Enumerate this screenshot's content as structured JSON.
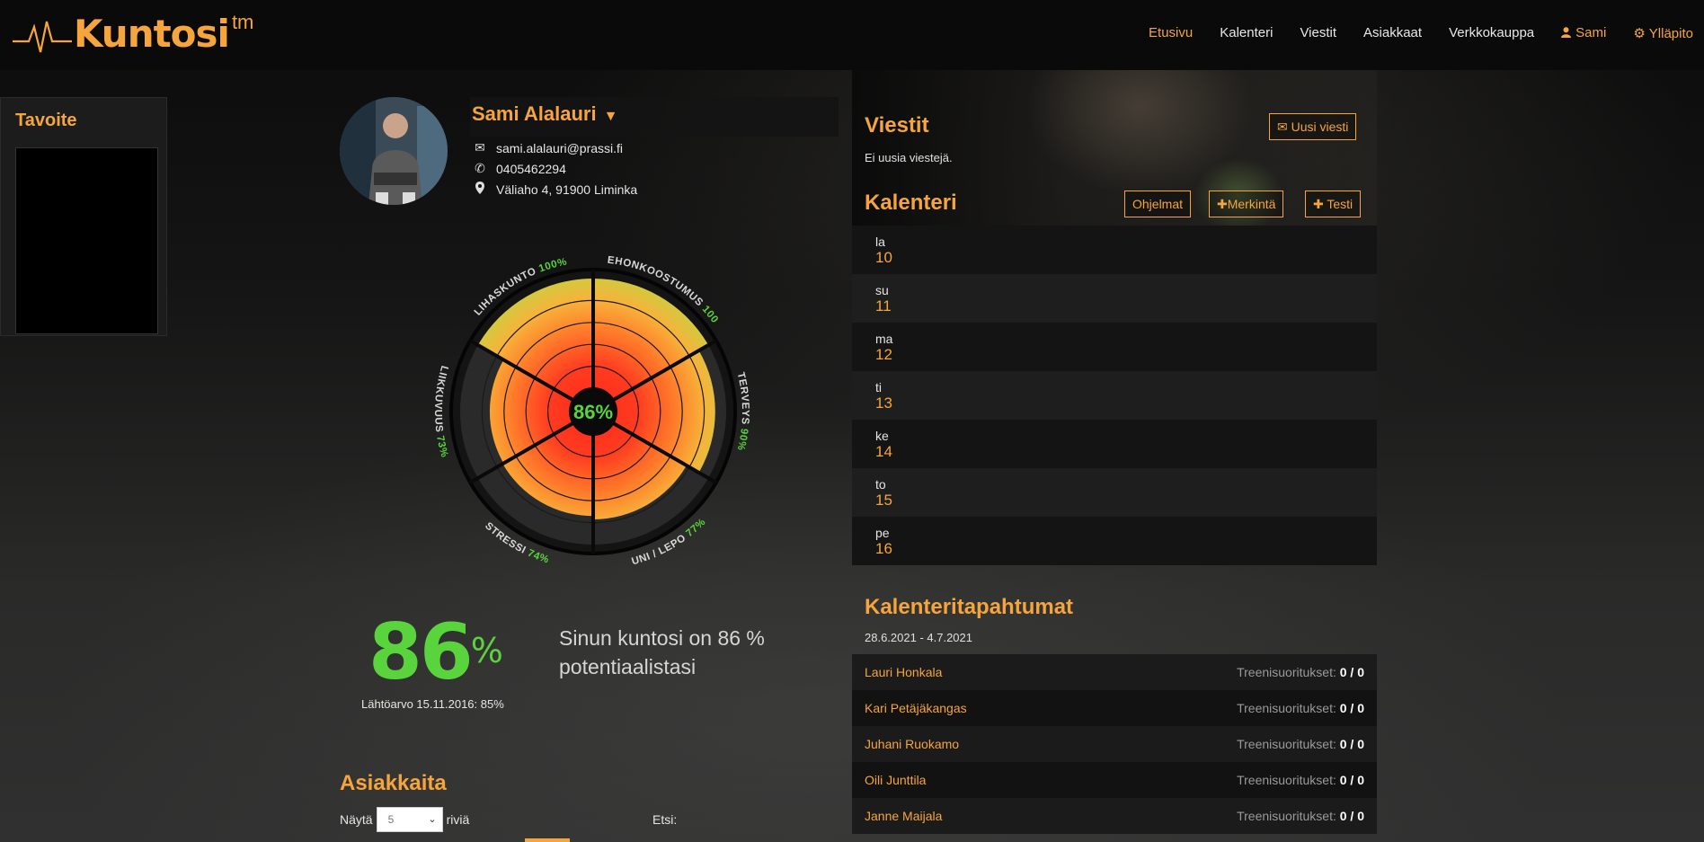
{
  "header": {
    "brand": "Kuntosi",
    "tm": "tm",
    "nav": [
      "Etusivu",
      "Kalenteri",
      "Viestit",
      "Asiakkaat",
      "Verkkokauppa"
    ],
    "user": "Sami",
    "admin": "Ylläpito",
    "accent_color": "#f5a53c"
  },
  "tavoite": {
    "title": "Tavoite",
    "value": ""
  },
  "profile": {
    "name": "Sami Alalauri",
    "email": "sami.alalauri@prassi.fi",
    "phone": "0405462294",
    "address": "Väliaho 4, 91900 Liminka"
  },
  "wheel": {
    "center": "86%",
    "segments": [
      {
        "label": "KEHONKOOSTUMUS",
        "pct": "100%",
        "value": 100
      },
      {
        "label": "TERVEYS",
        "pct": "90%",
        "value": 90
      },
      {
        "label": "UNI / LEPO",
        "pct": "77%",
        "value": 77
      },
      {
        "label": "STRESSI",
        "pct": "74%",
        "value": 74
      },
      {
        "label": "LIIKKUVUUS",
        "pct": "73%",
        "value": 73
      },
      {
        "label": "LIHASKUNTO",
        "pct": "100%",
        "value": 100
      }
    ]
  },
  "score": {
    "value": "86",
    "unit": "%",
    "baseline": "Lähtöarvo 15.11.2016: 85%",
    "text": "Sinun kuntosi on 86 % potentiaalistasi"
  },
  "asiakkaita": {
    "title": "Asiakkaita",
    "show_label": "Näytä",
    "rows_value": "5",
    "rows_label": "riviä",
    "search_label": "Etsi:"
  },
  "viestit": {
    "title": "Viestit",
    "new_button": "Uusi viesti",
    "empty": "Ei uusia viestejä."
  },
  "kalenteri": {
    "title": "Kalenteri",
    "buttons": [
      "Ohjelmat",
      "Merkintä",
      "Testi"
    ],
    "days": [
      {
        "day": "la",
        "date": "10"
      },
      {
        "day": "su",
        "date": "11"
      },
      {
        "day": "ma",
        "date": "12"
      },
      {
        "day": "ti",
        "date": "13"
      },
      {
        "day": "ke",
        "date": "14"
      },
      {
        "day": "to",
        "date": "15"
      },
      {
        "day": "pe",
        "date": "16"
      }
    ]
  },
  "tapahtumat": {
    "title": "Kalenteritapahtumat",
    "range": "28.6.2021 - 4.7.2021",
    "label": "Treenisuoritukset:",
    "rows": [
      {
        "name": "Lauri Honkala",
        "count": "0 / 0"
      },
      {
        "name": "Kari Petäjäkangas",
        "count": "0 / 0"
      },
      {
        "name": "Juhani Ruokamo",
        "count": "0 / 0"
      },
      {
        "name": "Oili Junttila",
        "count": "0 / 0"
      },
      {
        "name": "Janne Maijala",
        "count": "0 / 0"
      }
    ]
  }
}
